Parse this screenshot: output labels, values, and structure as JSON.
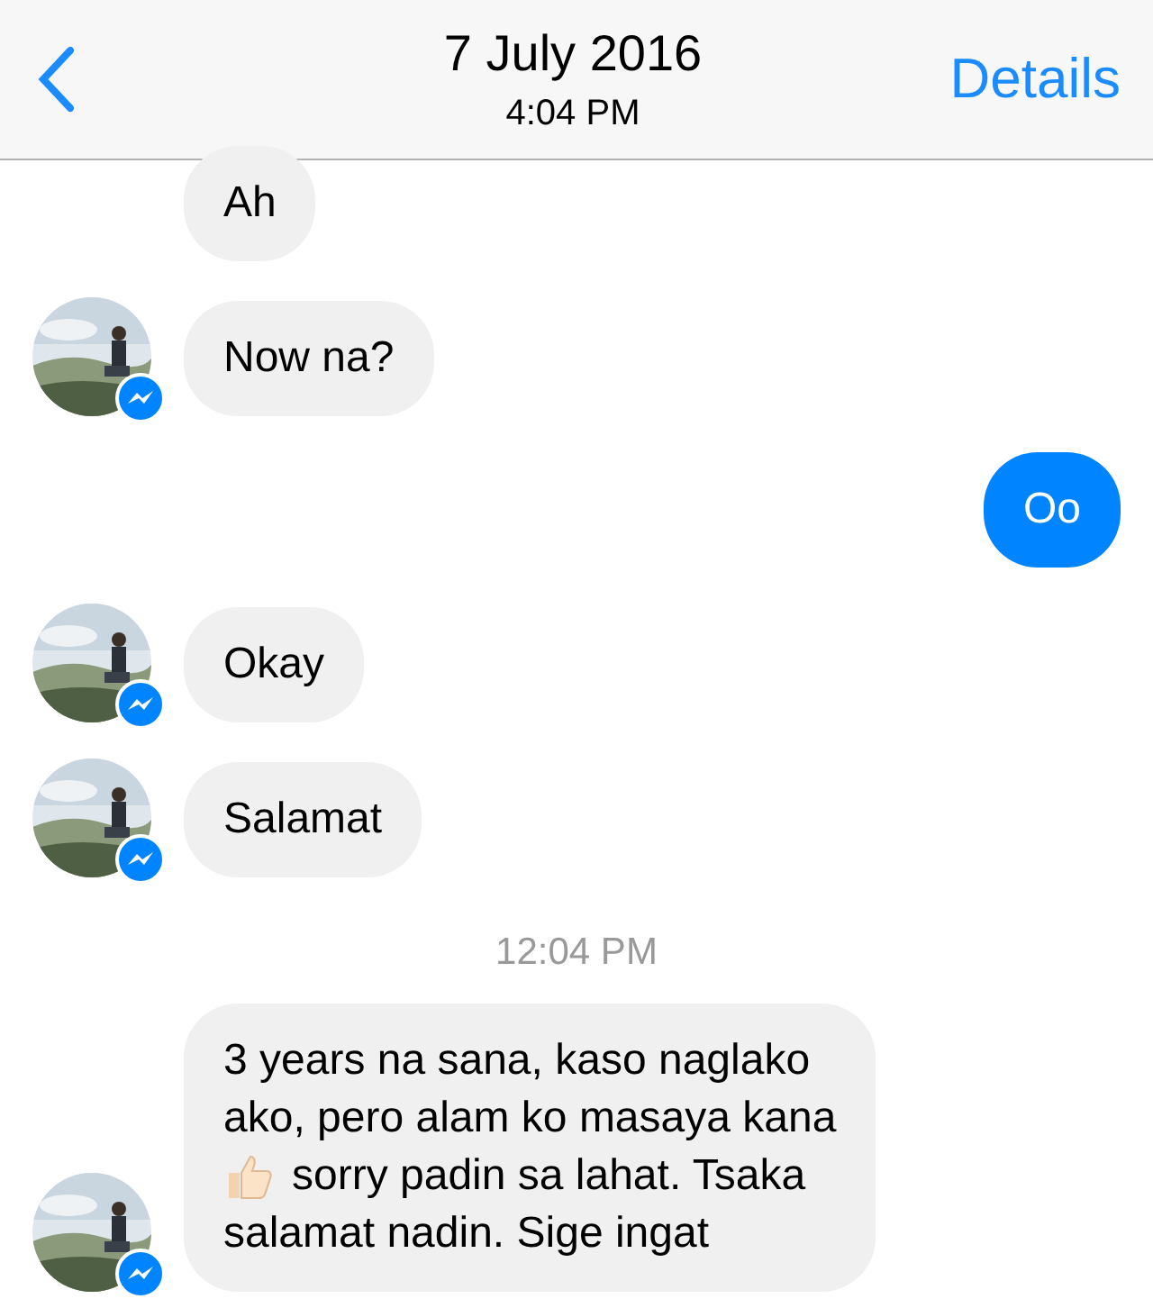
{
  "header": {
    "date": "7 July 2016",
    "time": "4:04 PM",
    "action": "Details"
  },
  "messages": [
    {
      "kind": "incoming",
      "avatar": false,
      "lines": [
        {
          "text": "Ah",
          "emoji": false
        }
      ]
    },
    {
      "kind": "incoming",
      "avatar": true,
      "lines": [
        {
          "text": "Now na?",
          "emoji": false
        }
      ]
    },
    {
      "kind": "outgoing",
      "avatar": false,
      "lines": [
        {
          "text": "Oo",
          "emoji": false
        }
      ]
    },
    {
      "kind": "incoming",
      "avatar": true,
      "lines": [
        {
          "text": "Okay",
          "emoji": false
        }
      ]
    },
    {
      "kind": "incoming",
      "avatar": true,
      "lines": [
        {
          "text": "Salamat",
          "emoji": false
        }
      ]
    },
    {
      "kind": "timestamp",
      "text": "12:04 PM"
    },
    {
      "kind": "incoming",
      "avatar": true,
      "lines": [
        {
          "text": "3 years na sana, kaso naglako",
          "emoji": false
        },
        {
          "text": "ako, pero alam ko masaya kana",
          "emoji": false
        },
        {
          "text": "sorry padin sa lahat. Tsaka",
          "emoji": true
        },
        {
          "text": "salamat nadin. Sige ingat",
          "emoji": false
        }
      ]
    }
  ]
}
